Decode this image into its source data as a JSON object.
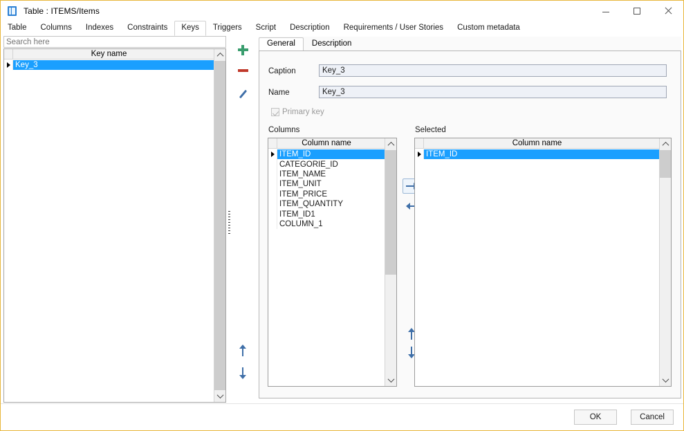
{
  "window": {
    "title": "Table : ITEMS/Items",
    "icon": "table-icon",
    "minimize_label": "Minimize",
    "maximize_label": "Maximize",
    "close_label": "Close"
  },
  "main_tabs": [
    {
      "label": "Table",
      "active": false
    },
    {
      "label": "Columns",
      "active": false
    },
    {
      "label": "Indexes",
      "active": false
    },
    {
      "label": "Constraints",
      "active": false
    },
    {
      "label": "Keys",
      "active": true
    },
    {
      "label": "Triggers",
      "active": false
    },
    {
      "label": "Script",
      "active": false
    },
    {
      "label": "Description",
      "active": false
    },
    {
      "label": "Requirements / User Stories",
      "active": false
    },
    {
      "label": "Custom metadata",
      "active": false
    }
  ],
  "left_panel": {
    "search": {
      "value": "",
      "placeholder": "Search here"
    },
    "list": {
      "header": "Key name",
      "rows": [
        {
          "name": "Key_3",
          "selected": true
        }
      ]
    },
    "toolbar": [
      {
        "name": "add-key-button",
        "icon": "plus-icon",
        "label": "Add"
      },
      {
        "name": "remove-key-button",
        "icon": "minus-icon",
        "label": "Remove"
      },
      {
        "name": "edit-key-button",
        "icon": "pencil-icon",
        "label": "Edit"
      }
    ],
    "order_buttons": [
      {
        "name": "move-key-up-button",
        "icon": "arrow-up-icon",
        "label": "Move up"
      },
      {
        "name": "move-key-down-button",
        "icon": "arrow-down-icon",
        "label": "Move down"
      }
    ]
  },
  "detail_tabs": [
    {
      "label": "General",
      "active": true
    },
    {
      "label": "Description",
      "active": false
    }
  ],
  "general": {
    "caption_label": "Caption",
    "caption_value": "Key_3",
    "name_label": "Name",
    "name_value": "Key_3",
    "primary_key_label": "Primary key",
    "primary_key_checked": true,
    "primary_key_disabled": true,
    "columns_group_label": "Columns",
    "selected_group_label": "Selected",
    "columns_header": "Column name",
    "selected_header": "Column name",
    "available_columns": [
      {
        "name": "ITEM_ID",
        "selected": true
      },
      {
        "name": "CATEGORIE_ID",
        "selected": false
      },
      {
        "name": "ITEM_NAME",
        "selected": false
      },
      {
        "name": "ITEM_UNIT",
        "selected": false
      },
      {
        "name": "ITEM_PRICE",
        "selected": false
      },
      {
        "name": "ITEM_QUANTITY",
        "selected": false
      },
      {
        "name": "ITEM_ID1",
        "selected": false
      },
      {
        "name": "COLUMN_1",
        "selected": false
      }
    ],
    "selected_columns": [
      {
        "name": "ITEM_ID",
        "selected": true
      }
    ],
    "transfer_buttons": [
      {
        "name": "add-column-button",
        "icon": "arrow-right-icon",
        "label": "Add column",
        "focused": true
      },
      {
        "name": "remove-column-button",
        "icon": "arrow-left-icon",
        "label": "Remove column",
        "focused": false
      }
    ],
    "reorder_buttons": [
      {
        "name": "move-column-up-button",
        "icon": "arrow-up-icon",
        "label": "Move up"
      },
      {
        "name": "move-column-down-button",
        "icon": "arrow-down-icon",
        "label": "Move down"
      }
    ]
  },
  "footer": {
    "ok_label": "OK",
    "cancel_label": "Cancel"
  },
  "colors": {
    "selection": "#1a9fff",
    "accent_blue": "#3f6fa8",
    "add_green": "#3a9d6e",
    "remove_red": "#c0392b",
    "window_border": "#e8b73a"
  }
}
